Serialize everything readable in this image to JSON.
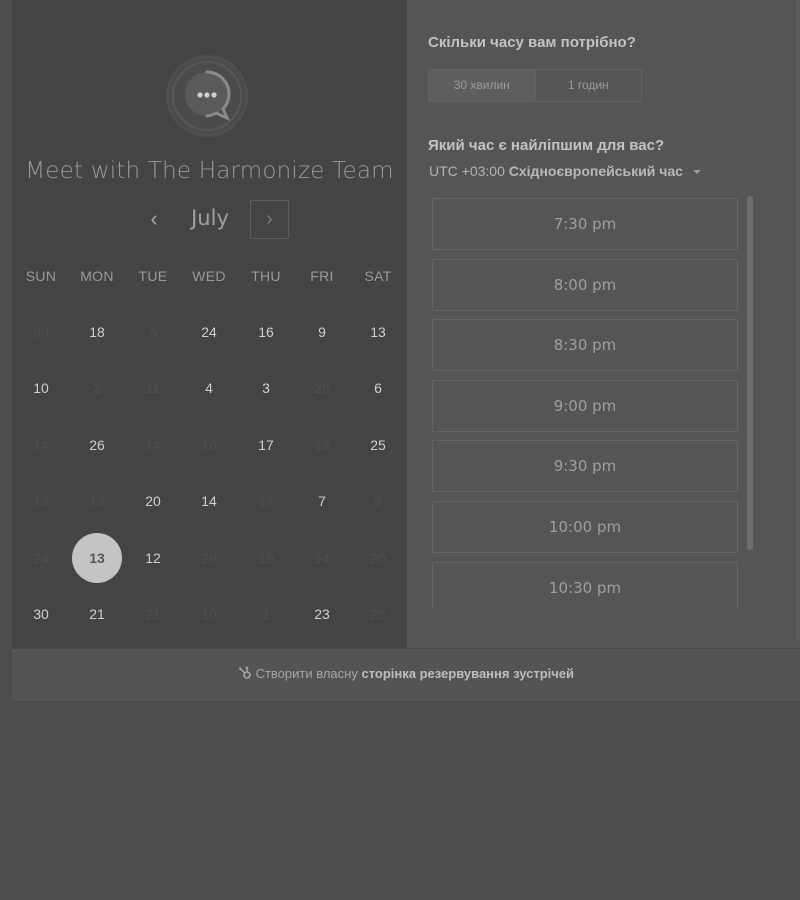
{
  "team_name": "Meet with The Harmonize Team",
  "calendar": {
    "month": "July",
    "prev_icon": "chevron-left",
    "next_icon": "chevron-right",
    "weekdays": [
      "SUN",
      "MON",
      "TUE",
      "WED",
      "THU",
      "FRI",
      "SAT"
    ],
    "weeks": [
      [
        {
          "d": "30",
          "m": true
        },
        {
          "d": "18",
          "m": false
        },
        {
          "d": "5",
          "m": true
        },
        {
          "d": "24",
          "m": false
        },
        {
          "d": "16",
          "m": false
        },
        {
          "d": "9",
          "m": false
        },
        {
          "d": "13",
          "m": false
        }
      ],
      [
        {
          "d": "10",
          "m": false
        },
        {
          "d": "2",
          "m": true
        },
        {
          "d": "11",
          "m": true
        },
        {
          "d": "4",
          "m": false
        },
        {
          "d": "3",
          "m": false
        },
        {
          "d": "28",
          "m": true
        },
        {
          "d": "6",
          "m": false
        }
      ],
      [
        {
          "d": "14",
          "m": true
        },
        {
          "d": "26",
          "m": false
        },
        {
          "d": "14",
          "m": true
        },
        {
          "d": "16",
          "m": true
        },
        {
          "d": "17",
          "m": false
        },
        {
          "d": "13",
          "m": true
        },
        {
          "d": "25",
          "m": false
        }
      ],
      [
        {
          "d": "13",
          "m": true
        },
        {
          "d": "13",
          "m": true
        },
        {
          "d": "20",
          "m": false
        },
        {
          "d": "14",
          "m": false
        },
        {
          "d": "17",
          "m": true
        },
        {
          "d": "7",
          "m": false
        },
        {
          "d": "9",
          "m": true
        }
      ],
      [
        {
          "d": "24",
          "m": true
        },
        {
          "d": "13",
          "m": false,
          "selected": true
        },
        {
          "d": "12",
          "m": false
        },
        {
          "d": "29",
          "m": true
        },
        {
          "d": "19",
          "m": true
        },
        {
          "d": "14",
          "m": true
        },
        {
          "d": "20",
          "m": true
        }
      ],
      [
        {
          "d": "30",
          "m": false
        },
        {
          "d": "21",
          "m": false
        },
        {
          "d": "21",
          "m": true
        },
        {
          "d": "10",
          "m": true
        },
        {
          "d": "1",
          "m": true
        },
        {
          "d": "23",
          "m": false
        },
        {
          "d": "25",
          "m": true
        }
      ]
    ]
  },
  "duration": {
    "heading": "Скільки часу вам потрібно?",
    "options": [
      "30 хвилин",
      "1 годин"
    ],
    "selected": "30 хвилин"
  },
  "time_selection": {
    "heading": "Який час є найліпшим для вас?",
    "timezone_offset": "UTC +03:00",
    "timezone_name": "Східноєвропейський час",
    "slots": [
      "7:30 pm",
      "8:00 pm",
      "8:30 pm",
      "9:00 pm",
      "9:30 pm",
      "10:00 pm",
      "10:30 pm"
    ]
  },
  "footer": {
    "icon": "hubspot-sprocket-icon",
    "text_plain": "Створити власну",
    "text_bold": "сторінка резервування зустрічей"
  },
  "colors": {
    "left_panel": "#444444",
    "right_panel": "#555555",
    "selected_day": "#c4c4c4"
  }
}
